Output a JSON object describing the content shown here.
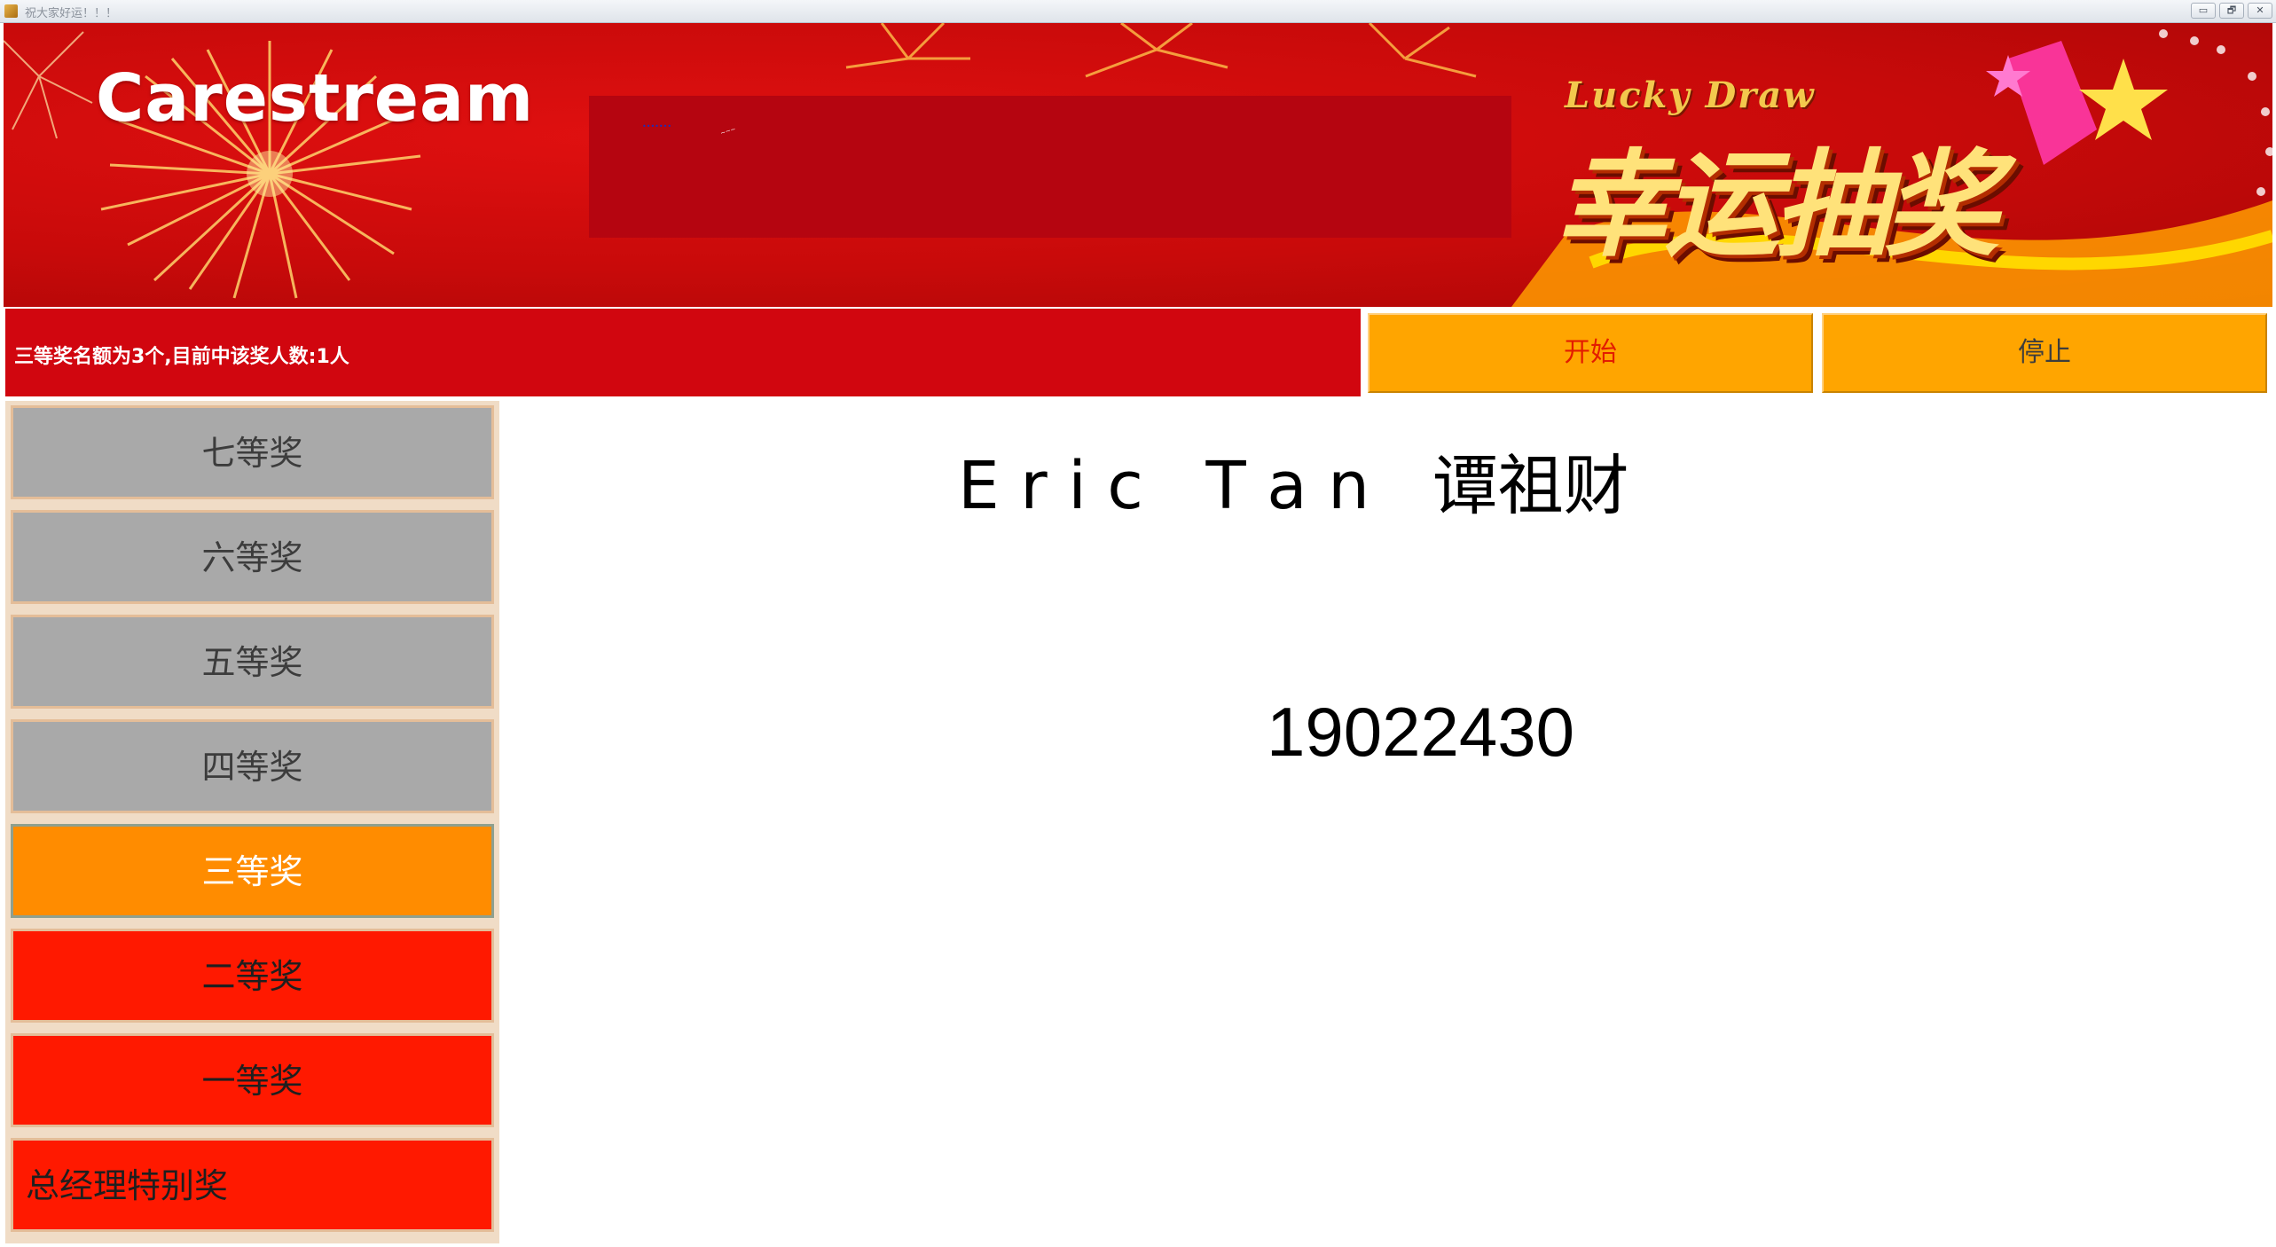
{
  "window": {
    "title": "祝大家好运！！！",
    "controls": [
      "▭",
      "🗗",
      "✕"
    ]
  },
  "banner": {
    "logo": "Carestream",
    "tiny_mark": "•••••••",
    "tiny_mark_2": "~~~",
    "lucky_draw_en": "Lucky Draw",
    "lucky_draw_cn": "幸运抽奖"
  },
  "status": {
    "message": "三等奖名额为3个,目前中该奖人数:1人"
  },
  "controls": {
    "start_label": "开始",
    "stop_label": "停止"
  },
  "prizes": [
    {
      "label": "七等奖",
      "state": "gray"
    },
    {
      "label": "六等奖",
      "state": "gray"
    },
    {
      "label": "五等奖",
      "state": "gray"
    },
    {
      "label": "四等奖",
      "state": "gray"
    },
    {
      "label": "三等奖",
      "state": "active"
    },
    {
      "label": "二等奖",
      "state": "red"
    },
    {
      "label": "一等奖",
      "state": "red"
    },
    {
      "label": "总经理特别奖",
      "state": "red"
    }
  ],
  "result": {
    "name": "E r i c   T a n   谭祖财",
    "employee_id": "19022430"
  },
  "colors": {
    "banner_red": "#c80a0a",
    "status_red": "#d1060f",
    "button_orange": "#ffa500",
    "active_orange": "#ff8c00",
    "prize_red": "#ff1900",
    "prize_gray": "#a9a9a9"
  }
}
